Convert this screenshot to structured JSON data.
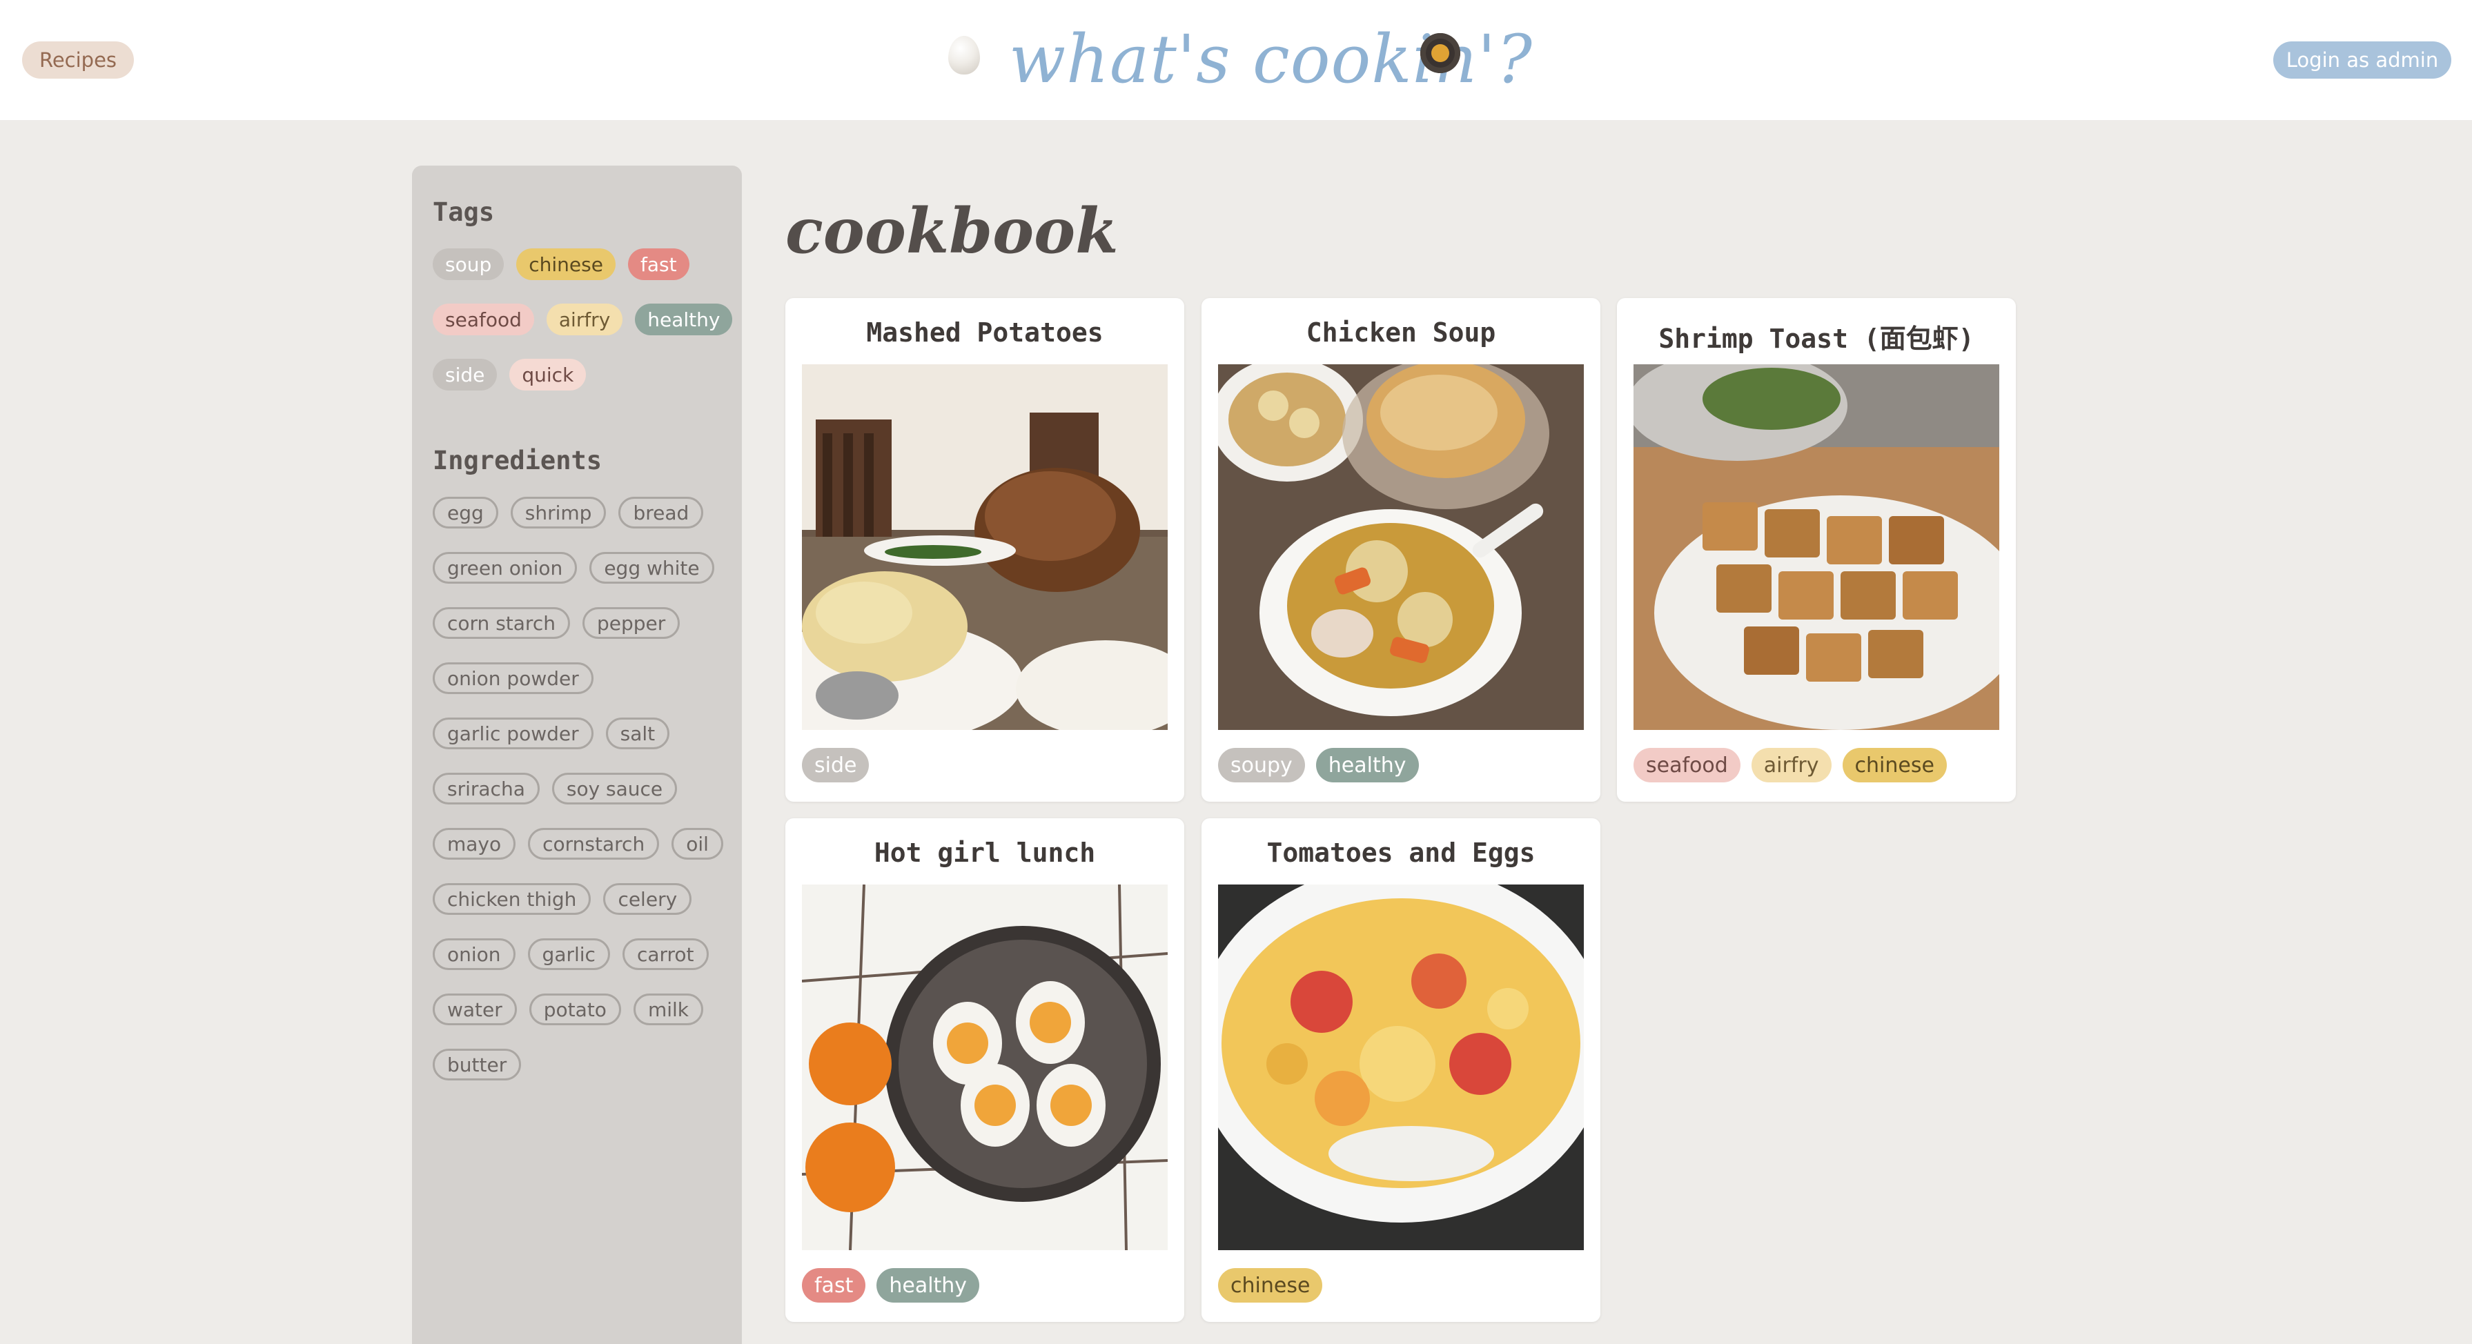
{
  "nav": {
    "recipes_label": "Recipes",
    "login_label": "Login as admin",
    "brand_title": "what's cookin'?"
  },
  "colors": {
    "soup": "#c5c1bd",
    "chinese": "#e9c86c",
    "fast": "#e48a84",
    "seafood": "#f2cbc6",
    "airfry": "#f4dfae",
    "healthy": "#8fa59c",
    "side": "#c5c1bd",
    "quick": "#f5dad3"
  },
  "sidebar": {
    "tags_heading": "Tags",
    "ingredients_heading": "Ingredients",
    "tags": [
      "soup",
      "chinese",
      "fast",
      "seafood",
      "airfry",
      "healthy",
      "side",
      "quick"
    ],
    "ingredients": [
      "egg",
      "shrimp",
      "bread",
      "green onion",
      "egg white",
      "corn starch",
      "pepper",
      "onion powder",
      "garlic powder",
      "salt",
      "sriracha",
      "soy sauce",
      "mayo",
      "cornstarch",
      "oil",
      "chicken thigh",
      "celery",
      "onion",
      "garlic",
      "carrot",
      "water",
      "potato",
      "milk",
      "butter"
    ]
  },
  "main": {
    "title": "cookbook",
    "recipes": [
      {
        "title": "Mashed Potatoes",
        "tags": [
          "side"
        ],
        "photo": "turkey-and-mashed-potatoes"
      },
      {
        "title": "Chicken Soup",
        "tags": [
          "soupy",
          "healthy"
        ],
        "photo": "chicken-soup-and-bread"
      },
      {
        "title": "Shrimp Toast (面包虾)",
        "tags": [
          "seafood",
          "airfry",
          "chinese"
        ],
        "photo": "shrimp-toast-plate"
      },
      {
        "title": "Hot girl lunch",
        "tags": [
          "fast",
          "healthy"
        ],
        "photo": "eggs-and-oranges"
      },
      {
        "title": "Tomatoes and Eggs",
        "tags": [
          "chinese"
        ],
        "photo": "tomato-egg-bowl"
      }
    ]
  }
}
